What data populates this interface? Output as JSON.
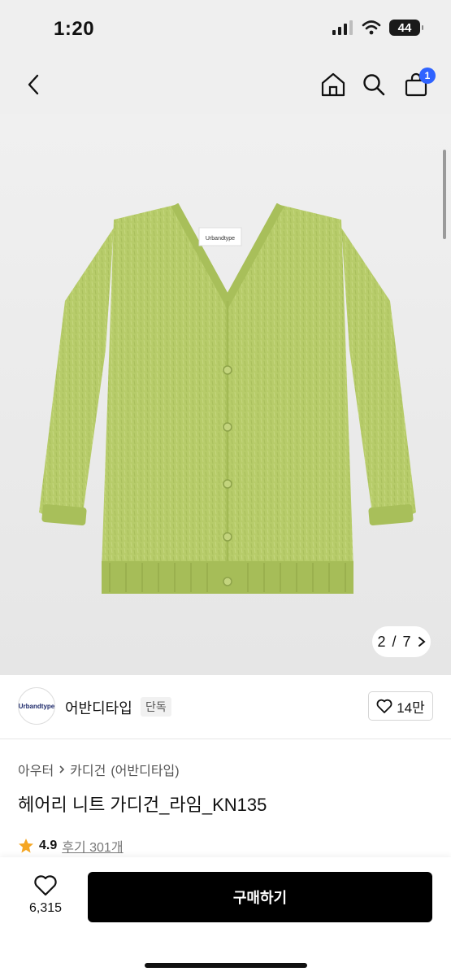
{
  "status_bar": {
    "time": "1:20",
    "battery": "44"
  },
  "nav": {
    "back_icon": "chevron-left-icon",
    "home_icon": "home-icon",
    "search_icon": "search-icon",
    "cart_icon": "shopping-bag-icon",
    "cart_count": "1"
  },
  "gallery": {
    "current": "2",
    "separator": "/",
    "total": "7",
    "label_on_garment": "Urbandtype"
  },
  "brand": {
    "logo_text": "Urbandtype",
    "name": "어반디타입",
    "tag": "단독",
    "likes": "14만"
  },
  "breadcrumb": {
    "category": "아우터",
    "subcategory": "카디건",
    "brand": "(어반디타입)"
  },
  "product": {
    "title": "헤어리 니트 가디건_라임_KN135",
    "rating": "4.9",
    "reviews": "후기 301개"
  },
  "bottom": {
    "wish_count": "6,315",
    "buy_label": "구매하기"
  },
  "colors": {
    "cart_badge": "#2f63ff",
    "star": "#f5a623",
    "cardigan": "#b7cc6a",
    "buy_button": "#000000"
  }
}
